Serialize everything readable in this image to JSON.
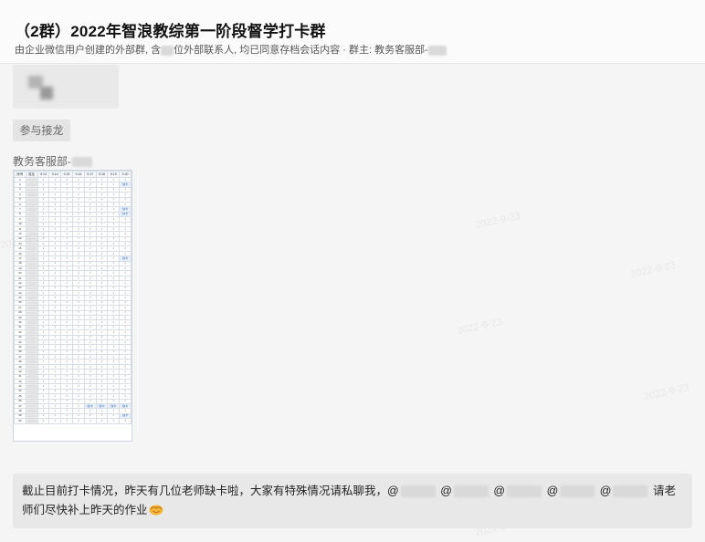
{
  "header": {
    "title": "（2群）2022年智浪教综第一阶段督学打卡群",
    "subtitle_pre": "由企业微信用户创建的外部群, 含",
    "subtitle_post": "位外部联系人, 均已同意存档会话内容 · 群主: 教务客服部-"
  },
  "join_button": {
    "label": "参与接龙"
  },
  "post": {
    "sender": "教务客服部-"
  },
  "sheet": {
    "headers": [
      "序号",
      "姓名",
      "9.13",
      "9.14",
      "9.15",
      "9.16",
      "9.17",
      "9.18",
      "9.19",
      "9.20"
    ],
    "row_count": 50,
    "check": "√",
    "miss": "缺卡"
  },
  "message": {
    "text": "截止目前打卡情况，昨天有几位老师缺卡啦，大家有特殊情况请私聊我，@",
    "mentions": [
      "@",
      "@",
      "@",
      "@"
    ],
    "tail": "请老师们尽快补上昨天的作业"
  },
  "watermark": {
    "text": "2022-9-23"
  },
  "colors": {
    "background": "#f5f5f5",
    "bubble": "#e8e8e8",
    "sheet_mark": "#e8f0fb"
  }
}
